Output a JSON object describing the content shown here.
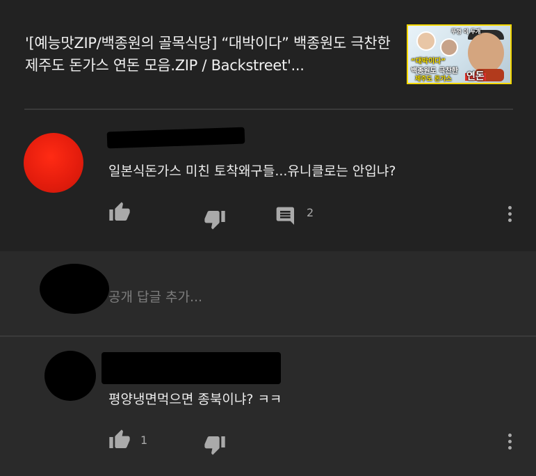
{
  "video": {
    "title": "'[예능맛ZIP/백종원의 골목식당] “대박이다” 백종원도 극찬한 제주도 돈가스 연돈 모음.ZIP / Backstreet'...",
    "thumbnail": {
      "caption_top": "뚜껑 이 두개",
      "caption_1": "“대박이다”",
      "caption_2": "백종원도 극찬한",
      "caption_3": "제주도 돈가스",
      "caption_badge": "연돈"
    }
  },
  "comments": [
    {
      "text": "일본식돈가스 미친 토착왜구들...유니클로는 안입냐?",
      "reply_count": "2",
      "avatar_color": "#e51d0d"
    },
    {
      "text": "평양냉면먹으면 종북이냐? ㅋㅋ",
      "like_count": "1"
    }
  ],
  "reply_box": {
    "placeholder": "공개 답글 추가..."
  },
  "colors": {
    "background": "#222222",
    "reply_background": "#2a2a2a",
    "icon": "#aaaaaa",
    "text": "#ececec"
  },
  "icons": {
    "like": "thumb-up-icon",
    "dislike": "thumb-down-icon",
    "reply": "comment-icon",
    "more": "more-vert-icon"
  }
}
